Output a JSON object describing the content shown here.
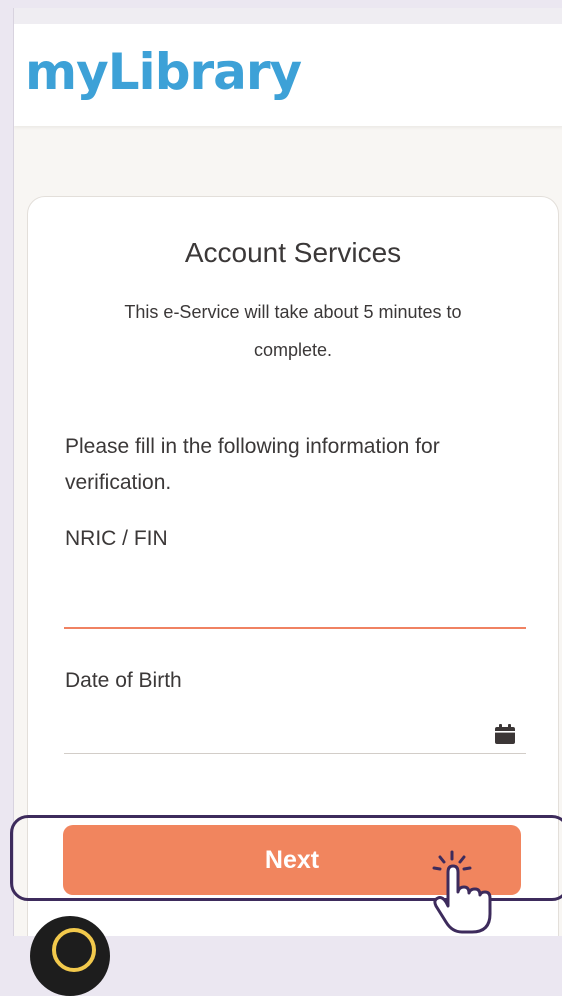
{
  "app": {
    "logo_text": "myLibrary",
    "brand_color": "#3da1d7",
    "accent_color": "#f1855e"
  },
  "card": {
    "title": "Account Services",
    "subtitle": "This e-Service will take about 5 minutes to complete.",
    "instruction": "Please fill in the following information for verification."
  },
  "form": {
    "nric_label": "NRIC / FIN",
    "nric_value": "",
    "dob_label": "Date of Birth",
    "dob_value": "",
    "calendar_icon": "calendar-icon"
  },
  "actions": {
    "next_label": "Next"
  }
}
